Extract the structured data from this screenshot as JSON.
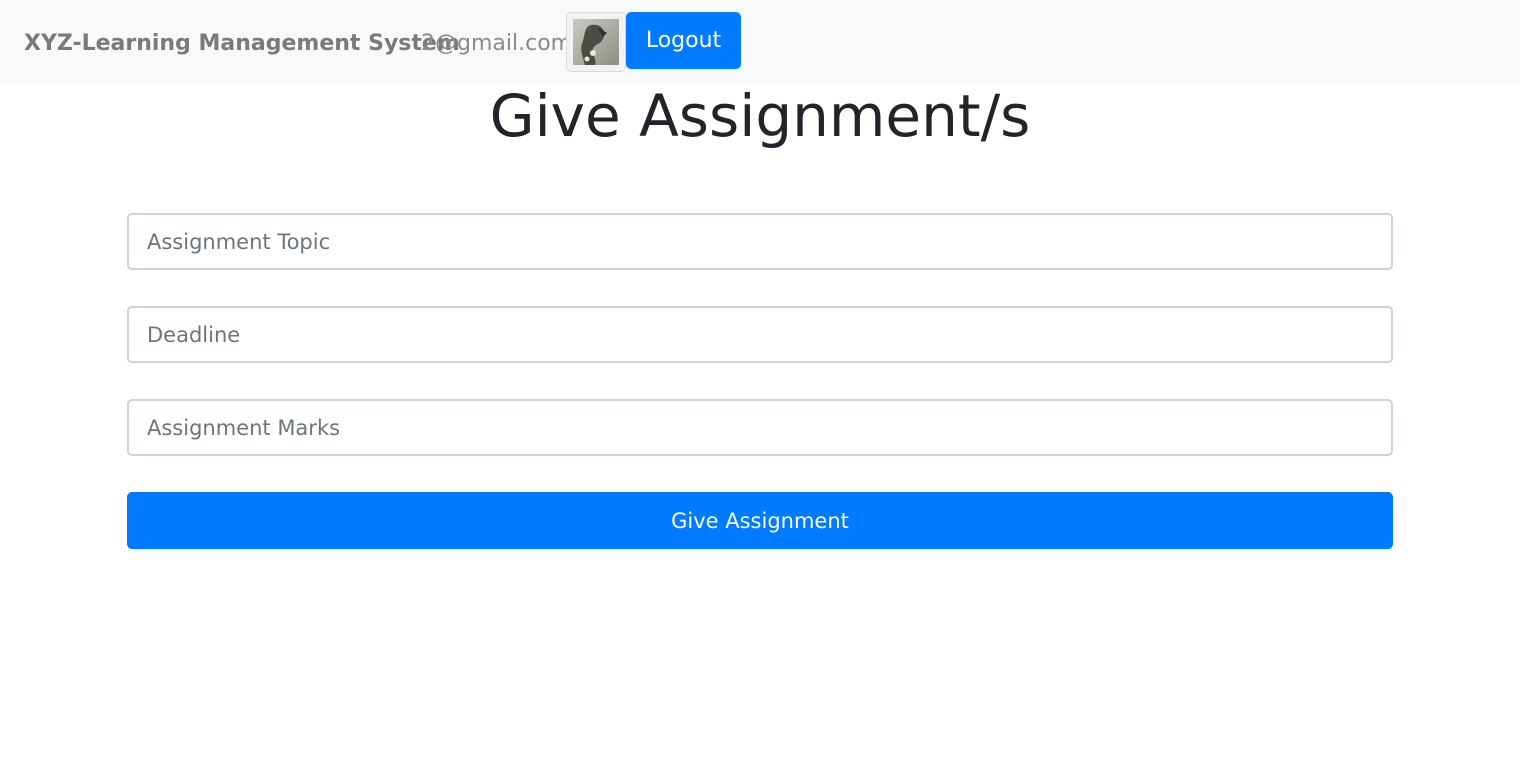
{
  "navbar": {
    "brand": "XYZ-Learning Management System",
    "email": "2@gmail.com",
    "avatar_icon": "profile-photo-icon",
    "logout_label": "Logout"
  },
  "page": {
    "title": "Give Assignment/s"
  },
  "form": {
    "topic": {
      "placeholder": "Assignment Topic",
      "value": ""
    },
    "deadline": {
      "placeholder": "Deadline",
      "value": ""
    },
    "marks": {
      "placeholder": "Assignment Marks",
      "value": ""
    },
    "submit_label": "Give Assignment"
  },
  "colors": {
    "primary": "#007bff",
    "navbar_bg": "#f8f9fa",
    "title_text": "#212529"
  }
}
